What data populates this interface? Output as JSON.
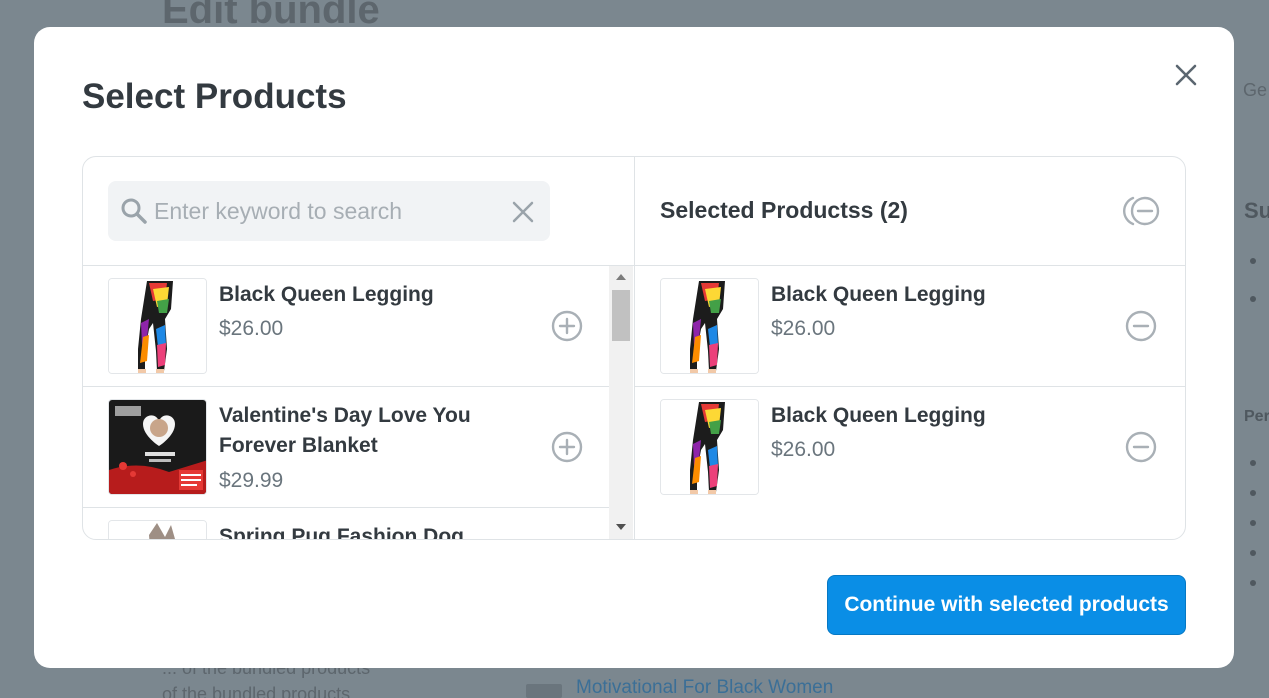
{
  "background": {
    "page_title": "Edit bundle",
    "right_text": "Ge",
    "right_heading": "Su",
    "right_heading_2": "Per",
    "bottom_left_lines": [
      "... of the bundled products",
      "of the bundled products"
    ],
    "bottom_link": "Motivational For Black Women"
  },
  "modal": {
    "title": "Select Products",
    "search": {
      "placeholder": "Enter keyword to search",
      "value": ""
    },
    "available_products": [
      {
        "name": "Black Queen Legging",
        "price": "$26.00",
        "thumb": "legging"
      },
      {
        "name": "Valentine's Day Love You Forever Blanket",
        "price": "$29.99",
        "thumb": "blanket"
      },
      {
        "name": "Spring Pug Fashion Dog",
        "price": "",
        "thumb": "dog"
      }
    ],
    "selected": {
      "heading": "Selected Productss (2)",
      "items": [
        {
          "name": "Black Queen Legging",
          "price": "$26.00",
          "thumb": "legging"
        },
        {
          "name": "Black Queen Legging",
          "price": "$26.00",
          "thumb": "legging"
        }
      ]
    },
    "continue_label": "Continue with selected products"
  },
  "icons": {
    "close": "close-icon",
    "search": "search-icon",
    "clear": "clear-search-icon",
    "add": "plus-circle-icon",
    "remove": "minus-circle-icon",
    "remove_all": "remove-all-icon"
  },
  "colors": {
    "primary": "#0a8ee6",
    "text": "#333a40",
    "muted": "#6a757d",
    "overlay": "#7b878f"
  }
}
